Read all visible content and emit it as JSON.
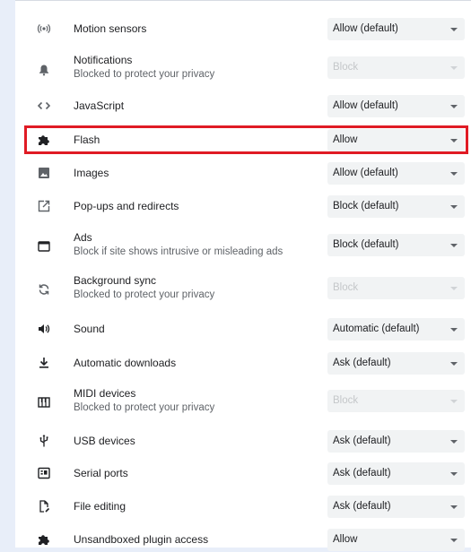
{
  "rows": [
    {
      "label": "Motion sensors",
      "sub": "",
      "value": "Allow (default)",
      "disabled": false,
      "icon": "sensors-icon"
    },
    {
      "label": "Notifications",
      "sub": "Blocked to protect your privacy",
      "value": "Block",
      "disabled": true,
      "icon": "bell-icon"
    },
    {
      "label": "JavaScript",
      "sub": "",
      "value": "Allow (default)",
      "disabled": false,
      "icon": "code-icon"
    },
    {
      "label": "Flash",
      "sub": "",
      "value": "Allow",
      "disabled": false,
      "icon": "puzzle-icon"
    },
    {
      "label": "Images",
      "sub": "",
      "value": "Allow (default)",
      "disabled": false,
      "icon": "image-icon"
    },
    {
      "label": "Pop-ups and redirects",
      "sub": "",
      "value": "Block (default)",
      "disabled": false,
      "icon": "open-in-new-icon"
    },
    {
      "label": "Ads",
      "sub": "Block if site shows intrusive or misleading ads",
      "value": "Block (default)",
      "disabled": false,
      "icon": "ads-icon"
    },
    {
      "label": "Background sync",
      "sub": "Blocked to protect your privacy",
      "value": "Block",
      "disabled": true,
      "icon": "sync-icon"
    },
    {
      "label": "Sound",
      "sub": "",
      "value": "Automatic (default)",
      "disabled": false,
      "icon": "volume-icon"
    },
    {
      "label": "Automatic downloads",
      "sub": "",
      "value": "Ask (default)",
      "disabled": false,
      "icon": "download-icon"
    },
    {
      "label": "MIDI devices",
      "sub": "Blocked to protect your privacy",
      "value": "Block",
      "disabled": true,
      "icon": "piano-icon"
    },
    {
      "label": "USB devices",
      "sub": "",
      "value": "Ask (default)",
      "disabled": false,
      "icon": "usb-icon"
    },
    {
      "label": "Serial ports",
      "sub": "",
      "value": "Ask (default)",
      "disabled": false,
      "icon": "serial-port-icon"
    },
    {
      "label": "File editing",
      "sub": "",
      "value": "Ask (default)",
      "disabled": false,
      "icon": "file-edit-icon"
    },
    {
      "label": "Unsandboxed plugin access",
      "sub": "",
      "value": "Allow",
      "disabled": false,
      "icon": "puzzle-icon"
    }
  ]
}
